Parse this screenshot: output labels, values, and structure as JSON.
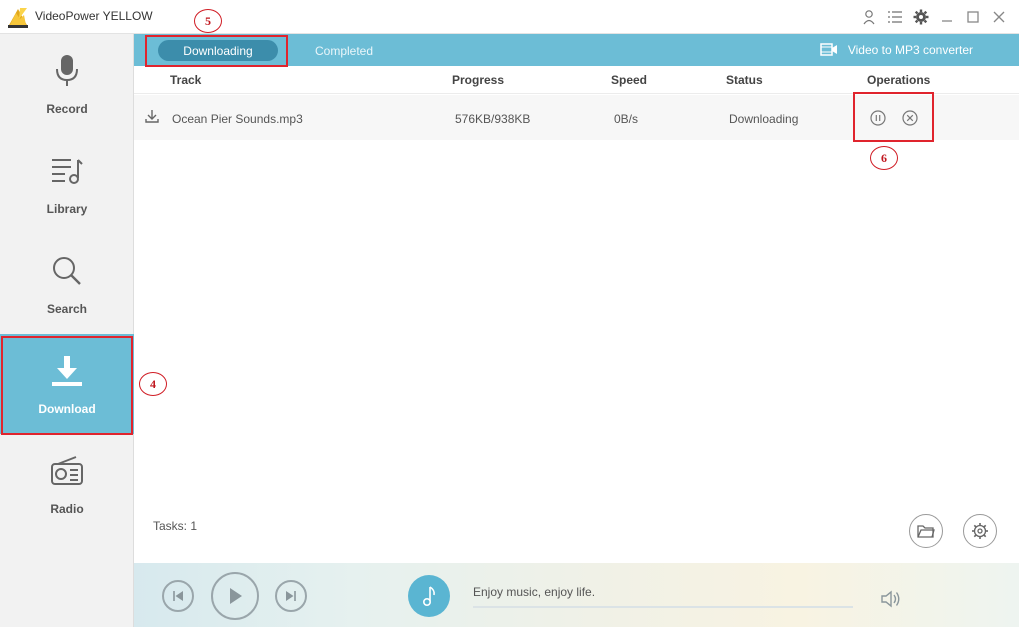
{
  "window": {
    "title": "VideoPower YELLOW"
  },
  "sidebar": {
    "items": [
      {
        "label": "Record",
        "icon": "microphone-icon"
      },
      {
        "label": "Library",
        "icon": "music-list-icon"
      },
      {
        "label": "Search",
        "icon": "magnifier-icon"
      },
      {
        "label": "Download",
        "icon": "download-icon",
        "active": true
      },
      {
        "label": "Radio",
        "icon": "radio-icon"
      }
    ]
  },
  "tabs": {
    "downloading": "Downloading",
    "completed": "Completed",
    "converter": "Video to MP3 converter"
  },
  "table": {
    "columns": {
      "track": "Track",
      "progress": "Progress",
      "speed": "Speed",
      "status": "Status",
      "operations": "Operations"
    },
    "rows": [
      {
        "track": "Ocean Pier Sounds.mp3",
        "progress": "576KB/938KB",
        "speed": "0B/s",
        "status": "Downloading"
      }
    ]
  },
  "footer": {
    "tasks": "Tasks: 1"
  },
  "player": {
    "tagline": "Enjoy music, enjoy life."
  },
  "annotations": {
    "sidebar_download": "4",
    "tab_downloading": "5",
    "operations": "6"
  },
  "colors": {
    "accent": "#6cbdd6",
    "accent_dark": "#3c8dab",
    "annotation_red": "#e0242d"
  }
}
